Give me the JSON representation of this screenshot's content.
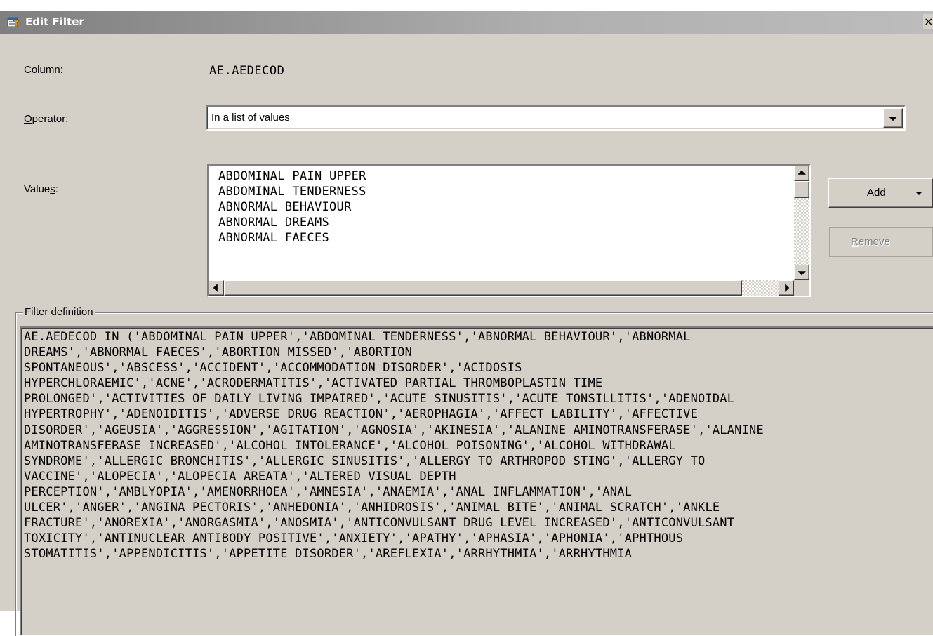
{
  "dialog": {
    "title": "Edit Filter",
    "close_label": "×"
  },
  "column": {
    "label": "Column:",
    "value": "AE.AEDECOD"
  },
  "operator": {
    "label_prefix": "O",
    "label_rest": "perator:",
    "selected": "In a list of values"
  },
  "values": {
    "label_prefix": "Value",
    "label_mnemonic": "s",
    "label_suffix": ":",
    "items": [
      "ABDOMINAL PAIN UPPER",
      "ABDOMINAL TENDERNESS",
      "ABNORMAL BEHAVIOUR",
      "ABNORMAL DREAMS",
      "ABNORMAL FAECES"
    ]
  },
  "buttons": {
    "add_mnemonic": "A",
    "add_rest": "dd",
    "remove_mnemonic": "R",
    "remove_rest": "emove"
  },
  "filter_definition": {
    "label": "Filter definition",
    "text_lines": [
      "AE.AEDECOD IN ('ABDOMINAL PAIN UPPER','ABDOMINAL TENDERNESS','ABNORMAL BEHAVIOUR','ABNORMAL",
      "DREAMS','ABNORMAL FAECES','ABORTION MISSED','ABORTION",
      "SPONTANEOUS','ABSCESS','ACCIDENT','ACCOMMODATION DISORDER','ACIDOSIS",
      "HYPERCHLORAEMIC','ACNE','ACRODERMATITIS','ACTIVATED PARTIAL THROMBOPLASTIN TIME",
      "PROLONGED','ACTIVITIES OF DAILY LIVING IMPAIRED','ACUTE SINUSITIS','ACUTE TONSILLITIS','ADENOIDAL",
      "HYPERTROPHY','ADENOIDITIS','ADVERSE DRUG REACTION','AEROPHAGIA','AFFECT LABILITY','AFFECTIVE",
      "DISORDER','AGEUSIA','AGGRESSION','AGITATION','AGNOSIA','AKINESIA','ALANINE AMINOTRANSFERASE','ALANINE",
      "AMINOTRANSFERASE INCREASED','ALCOHOL INTOLERANCE','ALCOHOL POISONING','ALCOHOL WITHDRAWAL",
      "SYNDROME','ALLERGIC BRONCHITIS','ALLERGIC SINUSITIS','ALLERGY TO ARTHROPOD STING','ALLERGY TO",
      "VACCINE','ALOPECIA','ALOPECIA AREATA','ALTERED VISUAL DEPTH",
      "PERCEPTION','AMBLYOPIA','AMENORRHOEA','AMNESIA','ANAEMIA','ANAL INFLAMMATION','ANAL",
      "ULCER','ANGER','ANGINA PECTORIS','ANHEDONIA','ANHIDROSIS','ANIMAL BITE','ANIMAL SCRATCH','ANKLE",
      "FRACTURE','ANOREXIA','ANORGASMIA','ANOSMIA','ANTICONVULSANT DRUG LEVEL INCREASED','ANTICONVULSANT",
      "TOXICITY','ANTINUCLEAR ANTIBODY POSITIVE','ANXIETY','APATHY','APHASIA','APHONIA','APHTHOUS",
      "STOMATITIS','APPENDICITIS','APPETITE DISORDER','AREFLEXIA','ARRHYTHMIA','ARRHYTHMIA"
    ]
  },
  "colors": {
    "dialog_bg": "#d4d0c8",
    "title_text": "#ffffff"
  }
}
